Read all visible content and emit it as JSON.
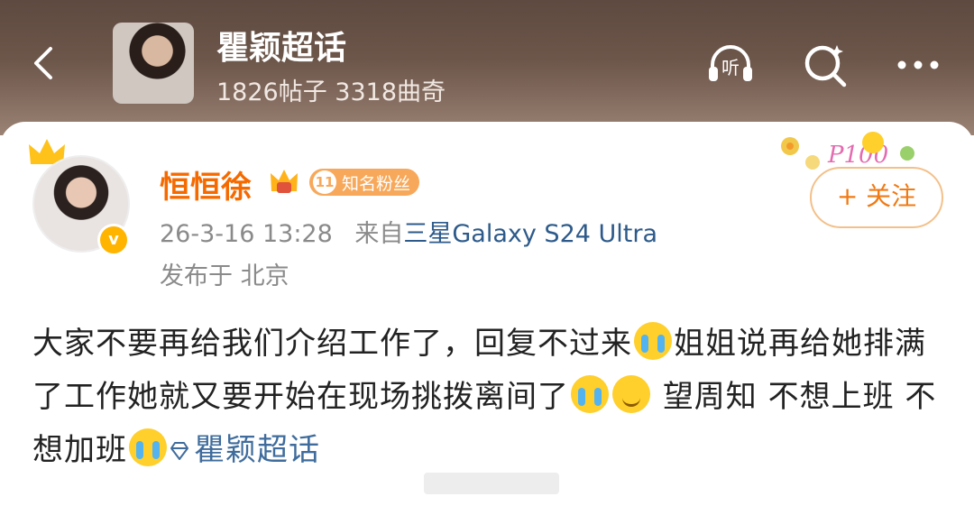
{
  "header": {
    "topic_title": "瞿颖超话",
    "stats": "1826帖子 3318曲奇",
    "listen_label": "听"
  },
  "post": {
    "username": "恒恒徐",
    "fan_badge": {
      "level": "11",
      "label": "知名粉丝"
    },
    "time": "26-3-16 13:28",
    "source_prefix": "来自",
    "device": "三星Galaxy S24 Ultra",
    "location": "发布于 北京",
    "follow_label": "+ 关注",
    "verified_mark": "v",
    "text_1": "大家不要再给我们介绍工作了，回复不过来",
    "text_2": "姐姐说再给她排满了工作她就又要开始在现场挑拨离间了",
    "text_3": "望周知 不想上班 不想加班",
    "topic_link": "瞿颖超话"
  },
  "colors": {
    "accent": "#f56a00",
    "link": "#3f6c9c",
    "header_bg": "#5e4a40"
  }
}
